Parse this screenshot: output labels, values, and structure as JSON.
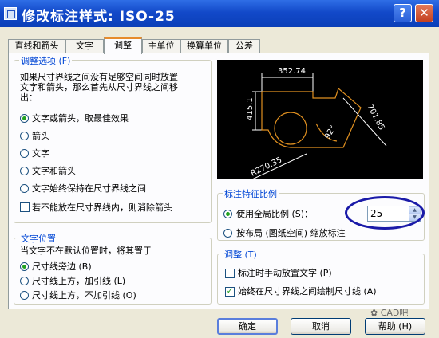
{
  "window": {
    "title": "修改标注样式: ISO-25"
  },
  "tabs": [
    "直线和箭头",
    "文字",
    "调整",
    "主单位",
    "换算单位",
    "公差"
  ],
  "fit": {
    "legend": "调整选项 (F)",
    "description": [
      "如果尺寸界线之间没有足够空间同时放置",
      "文字和箭头，那么首先从尺寸界线之间移",
      "出："
    ],
    "options": [
      "文字或箭头，取最佳效果",
      "箭头",
      "文字",
      "文字和箭头",
      "文字始终保持在尺寸界线之间"
    ],
    "selected": 0,
    "suppress_arrows": "若不能放在尺寸界线内，则消除箭头"
  },
  "text_placement": {
    "legend": "文字位置",
    "description": "当文字不在默认位置时，将其置于",
    "options": [
      "尺寸线旁边 (B)",
      "尺寸线上方，加引线 (L)",
      "尺寸线上方，不加引线 (O)"
    ],
    "selected": 0
  },
  "preview": {
    "dims": [
      "352.74",
      "415.1",
      "701.85",
      "92°",
      "R270.35"
    ]
  },
  "scale": {
    "legend": "标注特征比例",
    "use_overall": "使用全局比例 (S)：",
    "value": "25",
    "layout": "按布局 (图纸空间) 缩放标注",
    "selected": 0
  },
  "finetune": {
    "legend": "调整 (T)",
    "manual": "标注时手动放置文字 (P)",
    "always_draw": "始终在尺寸界线之间绘制尺寸线 (A)",
    "manual_checked": false,
    "always_checked": true
  },
  "buttons": {
    "ok": "确定",
    "cancel": "取消",
    "help": "帮助 (H)"
  },
  "watermark": "CAD吧",
  "colors": {
    "title_bar": "#1249c9",
    "legend_text": "#0046d5",
    "highlight_ellipse": "#1a1aa8"
  }
}
